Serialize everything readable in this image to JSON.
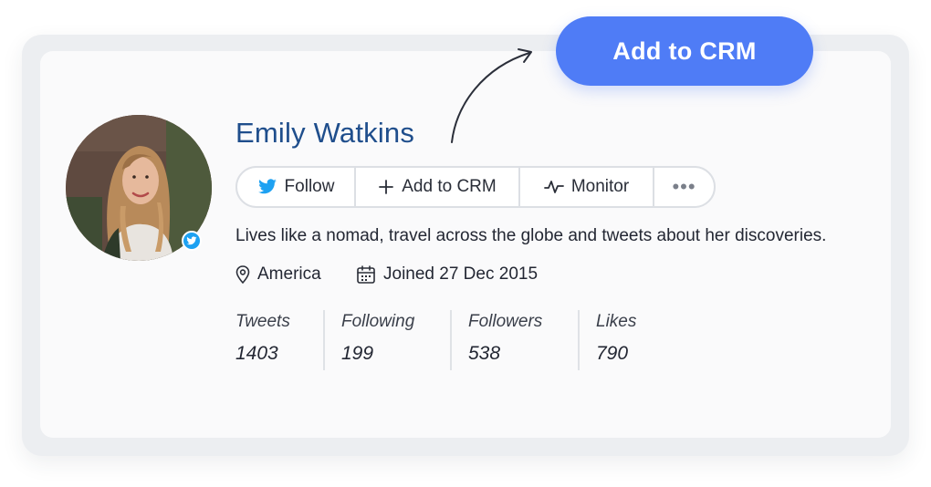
{
  "cta": {
    "label": "Add to CRM",
    "color": "#4f7cf6"
  },
  "profile": {
    "name": "Emily Watkins",
    "bio": "Lives like a nomad, travel across the globe and tweets about her discoveries.",
    "location": "America",
    "joined": "Joined 27 Dec 2015",
    "verified_icon": "twitter-bird-icon"
  },
  "actions": {
    "follow": "Follow",
    "add_to_crm": "Add to CRM",
    "monitor": "Monitor",
    "more": "•••"
  },
  "stats": [
    {
      "label": "Tweets",
      "value": "1403"
    },
    {
      "label": "Following",
      "value": "199"
    },
    {
      "label": "Followers",
      "value": "538"
    },
    {
      "label": "Likes",
      "value": "790"
    }
  ],
  "colors": {
    "name": "#1f4e8c",
    "twitter": "#1da1f2"
  }
}
